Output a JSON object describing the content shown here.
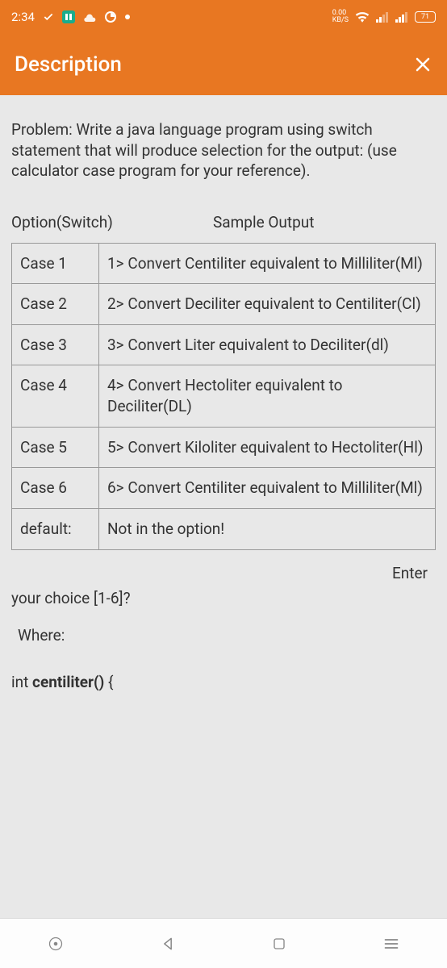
{
  "status": {
    "time": "2:34",
    "speed_value": "0.00",
    "speed_unit": "KB/S",
    "battery": "71"
  },
  "header": {
    "title": "Description"
  },
  "content": {
    "problem_label": "Problem",
    "problem_text": ": Write a java language program using switch statement that will produce selection for the output: (use calculator case program for your reference).",
    "option_header": "Option(Switch)",
    "sample_header": "Sample Output",
    "cases": [
      {
        "label": "Case 1",
        "desc": "1>    Convert Centiliter equivalent to Milliliter(Ml)"
      },
      {
        "label": "Case 2",
        "desc": "2>    Convert Deciliter equivalent to Centiliter(Cl)"
      },
      {
        "label": "Case 3",
        "desc": "3>    Convert Liter equivalent to Deciliter(dl)"
      },
      {
        "label": "Case 4",
        "desc": "4>    Convert Hectoliter equivalent to Deciliter(DL)"
      },
      {
        "label": "Case 5",
        "desc": "5>    Convert Kiloliter equivalent to Hectoliter(Hl)"
      },
      {
        "label": "Case 6",
        "desc": "6>    Convert Centiliter equivalent to Milliliter(Ml)"
      },
      {
        "label": "default:",
        "desc": "Not in the option!"
      }
    ],
    "enter_text": "Enter",
    "choice_text": "your choice [1-6]?",
    "where_text": "Where:",
    "func_prefix": "int ",
    "func_name": "centiliter()",
    "func_suffix": " {"
  }
}
